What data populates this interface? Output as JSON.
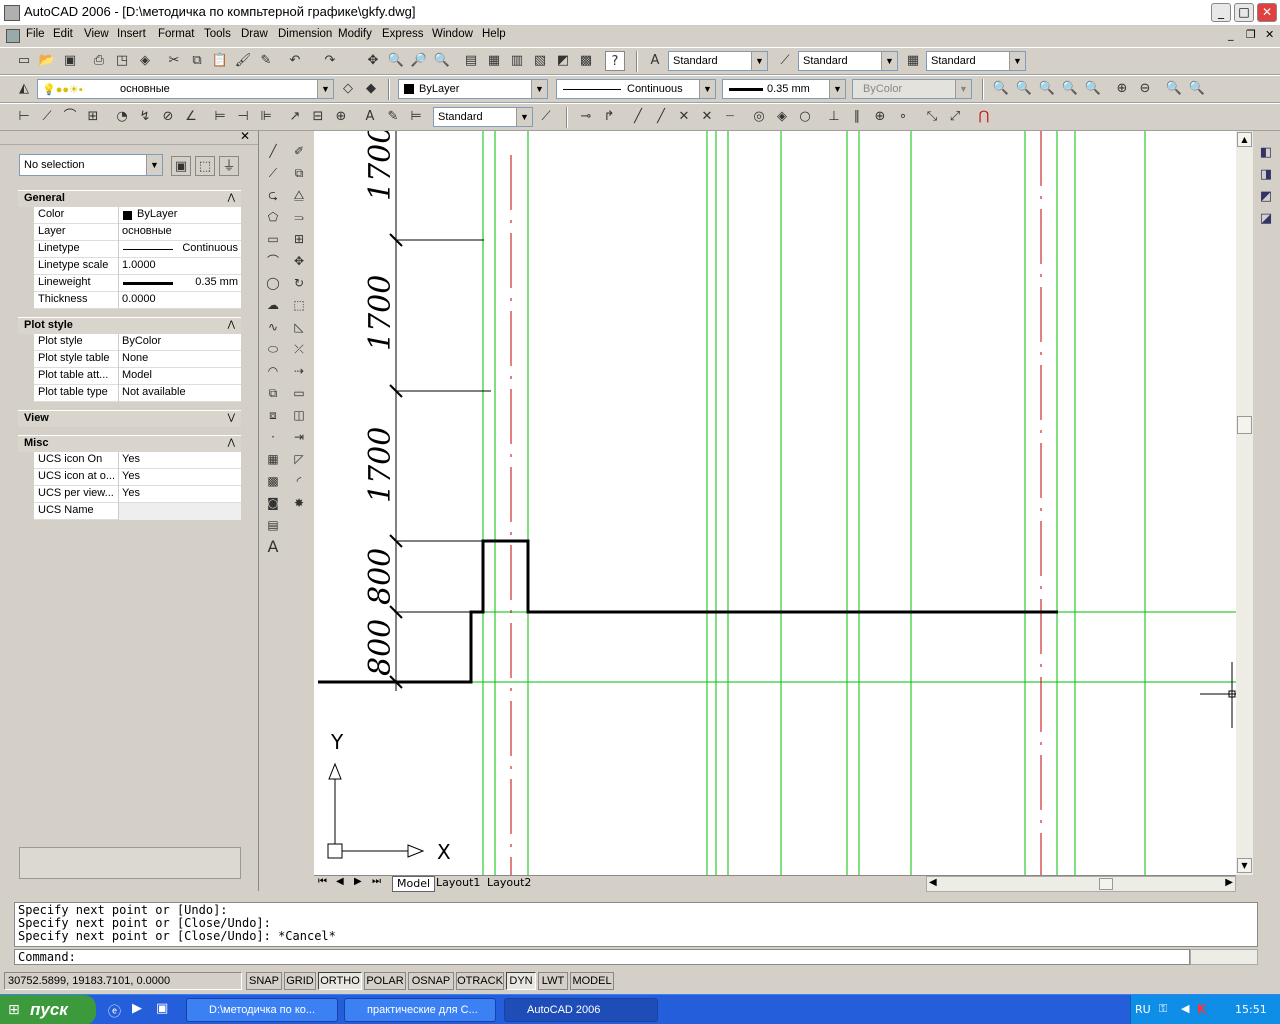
{
  "window": {
    "title": "AutoCAD 2006 - [D:\\методичка по компьтерной графике\\gkfy.dwg]",
    "min": "_",
    "max": "□",
    "close": "✕"
  },
  "menu": [
    "File",
    "Edit",
    "View",
    "Insert",
    "Format",
    "Tools",
    "Draw",
    "Dimension",
    "Modify",
    "Express",
    "Window",
    "Help"
  ],
  "toolbar": {
    "text_style": "Standard",
    "dim_style": "Standard",
    "table_style": "Standard",
    "layer": "основные",
    "color": "ByLayer",
    "linetype": "Continuous",
    "lineweight": "0.35 mm",
    "plotstyle": "ByColor",
    "mleader_style": "Standard"
  },
  "properties": {
    "selection": "No selection",
    "general": {
      "title": "General",
      "rows": [
        {
          "k": "Color",
          "v": "ByLayer"
        },
        {
          "k": "Layer",
          "v": "основные"
        },
        {
          "k": "Linetype",
          "v": "Continuous"
        },
        {
          "k": "Linetype scale",
          "v": "1.0000"
        },
        {
          "k": "Lineweight",
          "v": "0.35 mm"
        },
        {
          "k": "Thickness",
          "v": "0.0000"
        }
      ]
    },
    "plot": {
      "title": "Plot style",
      "rows": [
        {
          "k": "Plot style",
          "v": "ByColor"
        },
        {
          "k": "Plot style table",
          "v": "None"
        },
        {
          "k": "Plot table att...",
          "v": "Model"
        },
        {
          "k": "Plot table type",
          "v": "Not available"
        }
      ]
    },
    "view": {
      "title": "View"
    },
    "misc": {
      "title": "Misc",
      "rows": [
        {
          "k": "UCS icon On",
          "v": "Yes"
        },
        {
          "k": "UCS icon at o...",
          "v": "Yes"
        },
        {
          "k": "UCS per view...",
          "v": "Yes"
        },
        {
          "k": "UCS Name",
          "v": ""
        }
      ]
    }
  },
  "drawing": {
    "dims": [
      "1700",
      "1700",
      "1700",
      "800",
      "800",
      "800"
    ],
    "axis_y": "Y",
    "axis_x": "X"
  },
  "tabs": [
    "Model",
    "Layout1",
    "Layout2"
  ],
  "command": {
    "history": [
      "Specify next point or [Undo]:",
      "Specify next point or [Close/Undo]:",
      "Specify next point or [Close/Undo]: *Cancel*"
    ],
    "prompt": "Command:"
  },
  "status": {
    "coords": "30752.5899, 19183.7101, 0.0000",
    "buttons": [
      "SNAP",
      "GRID",
      "ORTHO",
      "POLAR",
      "OSNAP",
      "OTRACK",
      "DYN",
      "LWT",
      "MODEL"
    ]
  },
  "taskbar": {
    "start": "пуск",
    "tasks": [
      "D:\\методичка по ко...",
      "практические для С...",
      "AutoCAD 2006"
    ],
    "lang": "RU",
    "time": "15:51"
  },
  "colors": {
    "green": "#00c000",
    "red": "#c00000"
  }
}
